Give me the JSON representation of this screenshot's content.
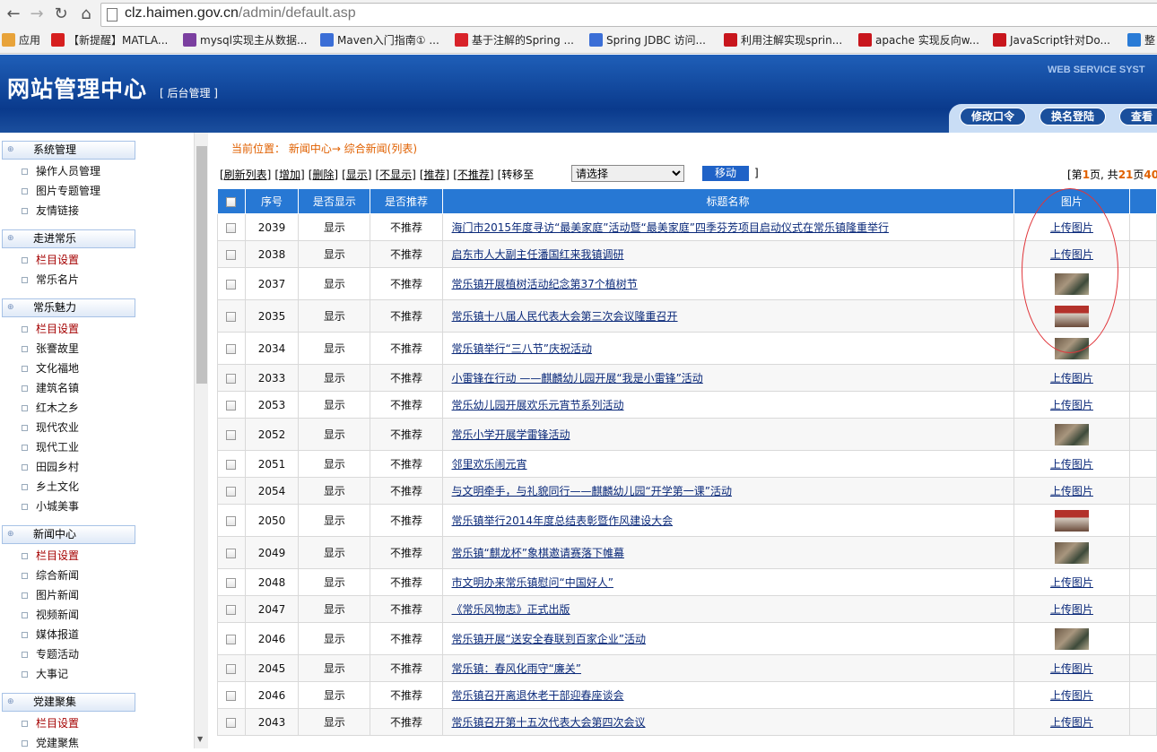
{
  "browser": {
    "url_host": "clz.haimen.gov.cn",
    "url_path": "/admin/default.asp",
    "bookmarks": [
      {
        "label": "应用",
        "icon": "apps-icon",
        "color": "#e8a33a"
      },
      {
        "label": "【新提醒】MATLA...",
        "icon": "red-bag-icon",
        "color": "#d61f1f"
      },
      {
        "label": "mysql实现主从数据...",
        "icon": "colorful-icon",
        "color": "#7b3fa0"
      },
      {
        "label": "Maven入门指南① ...",
        "icon": "globe-icon",
        "color": "#3b6ed6"
      },
      {
        "label": "基于注解的Spring ...",
        "icon": "baidu-icon",
        "color": "#d8232a"
      },
      {
        "label": "Spring JDBC 访问...",
        "icon": "globe-icon",
        "color": "#3b6ed6"
      },
      {
        "label": "利用注解实现sprin...",
        "icon": "csdn-icon",
        "color": "#c8161d"
      },
      {
        "label": "apache 实现反向w...",
        "icon": "csdn-icon",
        "color": "#c8161d"
      },
      {
        "label": "JavaScript针对Do...",
        "icon": "csdn-icon",
        "color": "#c8161d"
      },
      {
        "label": "整",
        "icon": "blue-icon",
        "color": "#2a7bd6"
      }
    ]
  },
  "header": {
    "logo": "网站管理中心",
    "subtitle": "[ 后台管理 ]",
    "tagline": "WEB SERVICE SYST",
    "buttons": [
      "修改口令",
      "换名登陆",
      "查看"
    ]
  },
  "sidebar": {
    "groups": [
      {
        "title": "系统管理",
        "items": [
          {
            "label": "操作人员管理",
            "red": false
          },
          {
            "label": "图片专题管理",
            "red": false
          },
          {
            "label": "友情链接",
            "red": false
          }
        ]
      },
      {
        "title": "走进常乐",
        "items": [
          {
            "label": "栏目设置",
            "red": true
          },
          {
            "label": "常乐名片",
            "red": false
          }
        ]
      },
      {
        "title": "常乐魅力",
        "items": [
          {
            "label": "栏目设置",
            "red": true
          },
          {
            "label": "张謇故里",
            "red": false
          },
          {
            "label": "文化福地",
            "red": false
          },
          {
            "label": "建筑名镇",
            "red": false
          },
          {
            "label": "红木之乡",
            "red": false
          },
          {
            "label": "现代农业",
            "red": false
          },
          {
            "label": "现代工业",
            "red": false
          },
          {
            "label": "田园乡村",
            "red": false
          },
          {
            "label": "乡土文化",
            "red": false
          },
          {
            "label": "小城美事",
            "red": false
          }
        ]
      },
      {
        "title": "新闻中心",
        "items": [
          {
            "label": "栏目设置",
            "red": true
          },
          {
            "label": "综合新闻",
            "red": false
          },
          {
            "label": "图片新闻",
            "red": false
          },
          {
            "label": "视频新闻",
            "red": false
          },
          {
            "label": "媒体报道",
            "red": false
          },
          {
            "label": "专题活动",
            "red": false
          },
          {
            "label": "大事记",
            "red": false
          }
        ]
      },
      {
        "title": "党建聚集",
        "items": [
          {
            "label": "栏目设置",
            "red": true
          },
          {
            "label": "党建聚焦",
            "red": false
          }
        ]
      }
    ]
  },
  "main": {
    "location": "当前位置： 新闻中心→ 综合新闻(列表)",
    "ops": [
      "[刷新列表]",
      "[增加]",
      "[删除]",
      "[显示]",
      "[不显示]",
      "[推荐]",
      "[不推荐]"
    ],
    "move_to_label": "[转移至",
    "select_value": "请选择",
    "move_button": "移动",
    "close_bracket": "]",
    "pager_prefix": "[第",
    "pager_page": "1",
    "pager_mid": "页, 共",
    "pager_total": "21",
    "pager_suffix": "页",
    "pager_extra": "40"
  },
  "table": {
    "headers": [
      "序号",
      "是否显示",
      "是否推荐",
      "标题名称",
      "图片"
    ],
    "upload_label": "上传图片",
    "rows": [
      {
        "id": "2039",
        "show": "显示",
        "rec": "不推荐",
        "title": "海门市2015年度寻访“最美家庭”活动暨“最美家庭”四季芬芳项目启动仪式在常乐镇隆重举行",
        "img": "upload"
      },
      {
        "id": "2038",
        "show": "显示",
        "rec": "不推荐",
        "title": "启东市人大副主任潘国红来我镇调研",
        "img": "upload"
      },
      {
        "id": "2037",
        "show": "显示",
        "rec": "不推荐",
        "title": "常乐镇开展植树活动纪念第37个植树节",
        "img": "thumb"
      },
      {
        "id": "2035",
        "show": "显示",
        "rec": "不推荐",
        "title": "常乐镇十八届人民代表大会第三次会议隆重召开",
        "img": "thumb-r"
      },
      {
        "id": "2034",
        "show": "显示",
        "rec": "不推荐",
        "title": "常乐镇举行“三八节”庆祝活动",
        "img": "thumb"
      },
      {
        "id": "2033",
        "show": "显示",
        "rec": "不推荐",
        "title": "小雷锋在行动 ——麒麟幼儿园开展“我是小雷锋”活动",
        "img": "upload"
      },
      {
        "id": "2053",
        "show": "显示",
        "rec": "不推荐",
        "title": "常乐幼儿园开展欢乐元宵节系列活动",
        "img": "upload"
      },
      {
        "id": "2052",
        "show": "显示",
        "rec": "不推荐",
        "title": "常乐小学开展学雷锋活动",
        "img": "thumb"
      },
      {
        "id": "2051",
        "show": "显示",
        "rec": "不推荐",
        "title": "邻里欢乐闹元宵",
        "img": "upload"
      },
      {
        "id": "2054",
        "show": "显示",
        "rec": "不推荐",
        "title": "与文明牵手，与礼貌同行——麒麟幼儿园“开学第一课”活动",
        "img": "upload"
      },
      {
        "id": "2050",
        "show": "显示",
        "rec": "不推荐",
        "title": "常乐镇举行2014年度总结表彰暨作风建设大会",
        "img": "thumb-r"
      },
      {
        "id": "2049",
        "show": "显示",
        "rec": "不推荐",
        "title": "常乐镇“麒龙杯”象棋邀请赛落下帷幕",
        "img": "thumb"
      },
      {
        "id": "2048",
        "show": "显示",
        "rec": "不推荐",
        "title": "市文明办来常乐镇慰问“中国好人”",
        "img": "upload"
      },
      {
        "id": "2047",
        "show": "显示",
        "rec": "不推荐",
        "title": "《常乐风物志》正式出版",
        "img": "upload"
      },
      {
        "id": "2046",
        "show": "显示",
        "rec": "不推荐",
        "title": "常乐镇开展“送安全春联到百家企业”活动",
        "img": "thumb"
      },
      {
        "id": "2045",
        "show": "显示",
        "rec": "不推荐",
        "title": "常乐镇：春风化雨守“廉关”",
        "img": "upload"
      },
      {
        "id": "2046",
        "show": "显示",
        "rec": "不推荐",
        "title": "常乐镇召开离退休老干部迎春座谈会",
        "img": "upload"
      },
      {
        "id": "2043",
        "show": "显示",
        "rec": "不推荐",
        "title": "常乐镇召开第十五次代表大会第四次会议",
        "img": "upload"
      }
    ]
  }
}
